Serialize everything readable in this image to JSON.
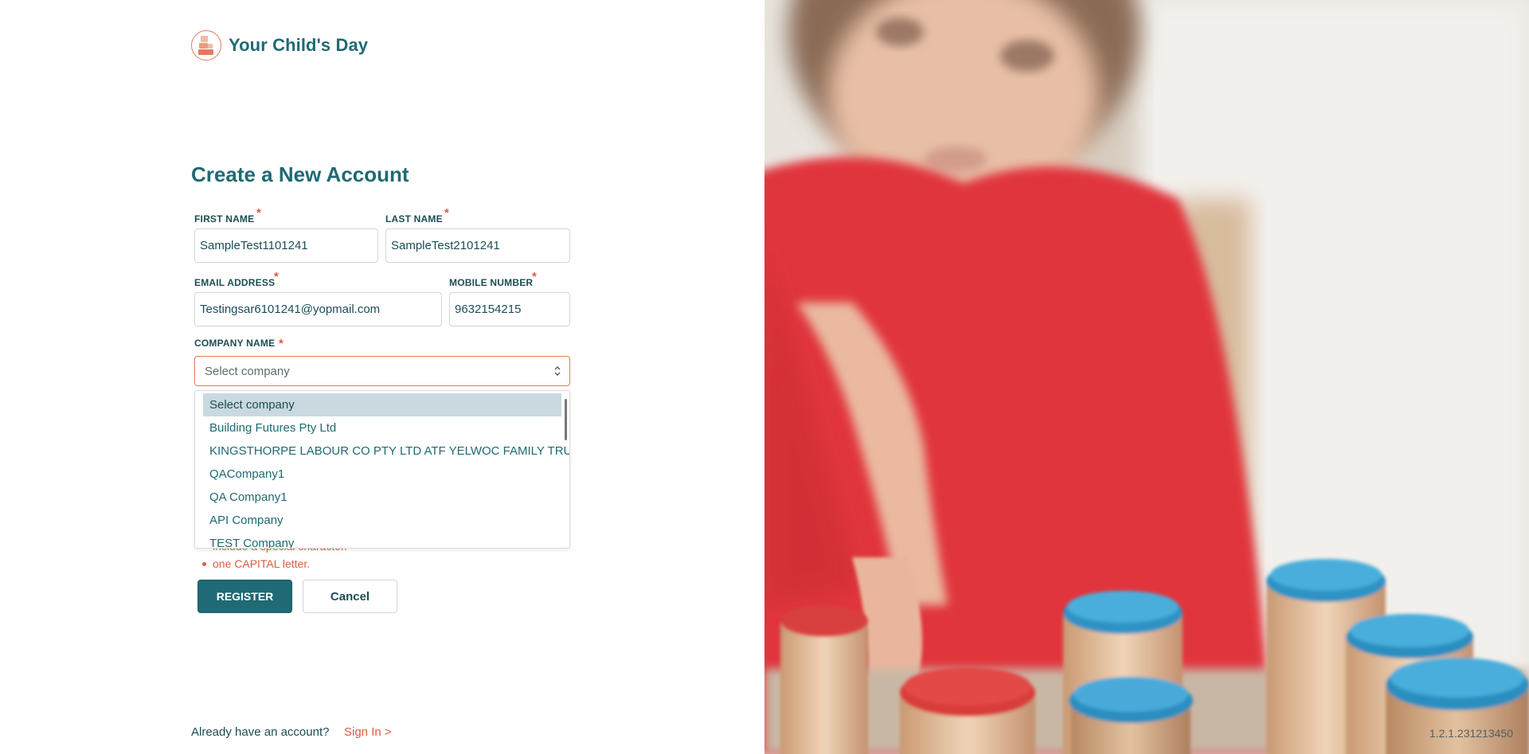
{
  "brand": {
    "name": "Your Child's Day",
    "logo_icon": "blocks-logo-icon"
  },
  "form": {
    "title": "Create a New Account",
    "first_name": {
      "label": "FIRST NAME",
      "value": "SampleTest1101241"
    },
    "last_name": {
      "label": "LAST NAME",
      "value": "SampleTest2101241"
    },
    "email": {
      "label": "EMAIL ADDRESS",
      "value": "Testingsar6101241@yopmail.com"
    },
    "mobile": {
      "label": "MOBILE NUMBER",
      "value": "9632154215"
    },
    "company": {
      "label": "COMPANY NAME",
      "selected": "Select company",
      "options": [
        "Select company",
        "Building Futures Pty Ltd",
        "KINGSTHORPE LABOUR CO PTY LTD ATF YELWOC FAMILY TRUST",
        "QACompany1",
        "QA Company1",
        "API Company",
        "TEST Company"
      ]
    },
    "required_marker": "*",
    "password_hints": [
      "include a special character.",
      "one CAPITAL letter."
    ],
    "register_label": "REGISTER",
    "cancel_label": "Cancel"
  },
  "footer": {
    "prompt": "Already have an account?",
    "signin_label": "Sign In >"
  },
  "version": "1.2.1.231213450",
  "colors": {
    "primary": "#1f6a74",
    "accent": "#e05b3c",
    "dropdown_highlight": "#c9d9df"
  }
}
